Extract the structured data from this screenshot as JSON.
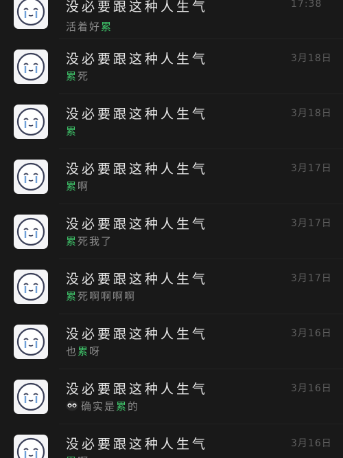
{
  "chats": [
    {
      "name": "没必要跟这种人生气",
      "date": "17:38",
      "pre": "活着好",
      "hl": "累",
      "post": ""
    },
    {
      "name": "没必要跟这种人生气",
      "date": "3月18日",
      "pre": "",
      "hl": "累",
      "post": "死"
    },
    {
      "name": "没必要跟这种人生气",
      "date": "3月18日",
      "pre": "",
      "hl": "累",
      "post": ""
    },
    {
      "name": "没必要跟这种人生气",
      "date": "3月17日",
      "pre": "",
      "hl": "累",
      "post": "啊"
    },
    {
      "name": "没必要跟这种人生气",
      "date": "3月17日",
      "pre": "",
      "hl": "累",
      "post": "死我了"
    },
    {
      "name": "没必要跟这种人生气",
      "date": "3月17日",
      "pre": "",
      "hl": "累",
      "post": "死啊啊啊啊"
    },
    {
      "name": "没必要跟这种人生气",
      "date": "3月16日",
      "pre": "也",
      "hl": "累",
      "post": "呀"
    },
    {
      "name": "没必要跟这种人生气",
      "date": "3月16日",
      "pre": "确实是",
      "hl": "累",
      "post": "的",
      "emoji": "crying-face-icon"
    },
    {
      "name": "没必要跟这种人生气",
      "date": "3月16日",
      "pre": "",
      "hl": "累",
      "post": "啊"
    }
  ],
  "colors": {
    "background": "#191919",
    "name": "#e7e7e7",
    "preview": "#8c8c8c",
    "highlight": "#3fc56a",
    "date": "#5f5f5f",
    "avatar_bg": "#f4f4f6",
    "avatar_outline": "#3a3f58",
    "tear": "#6fa0d8"
  }
}
